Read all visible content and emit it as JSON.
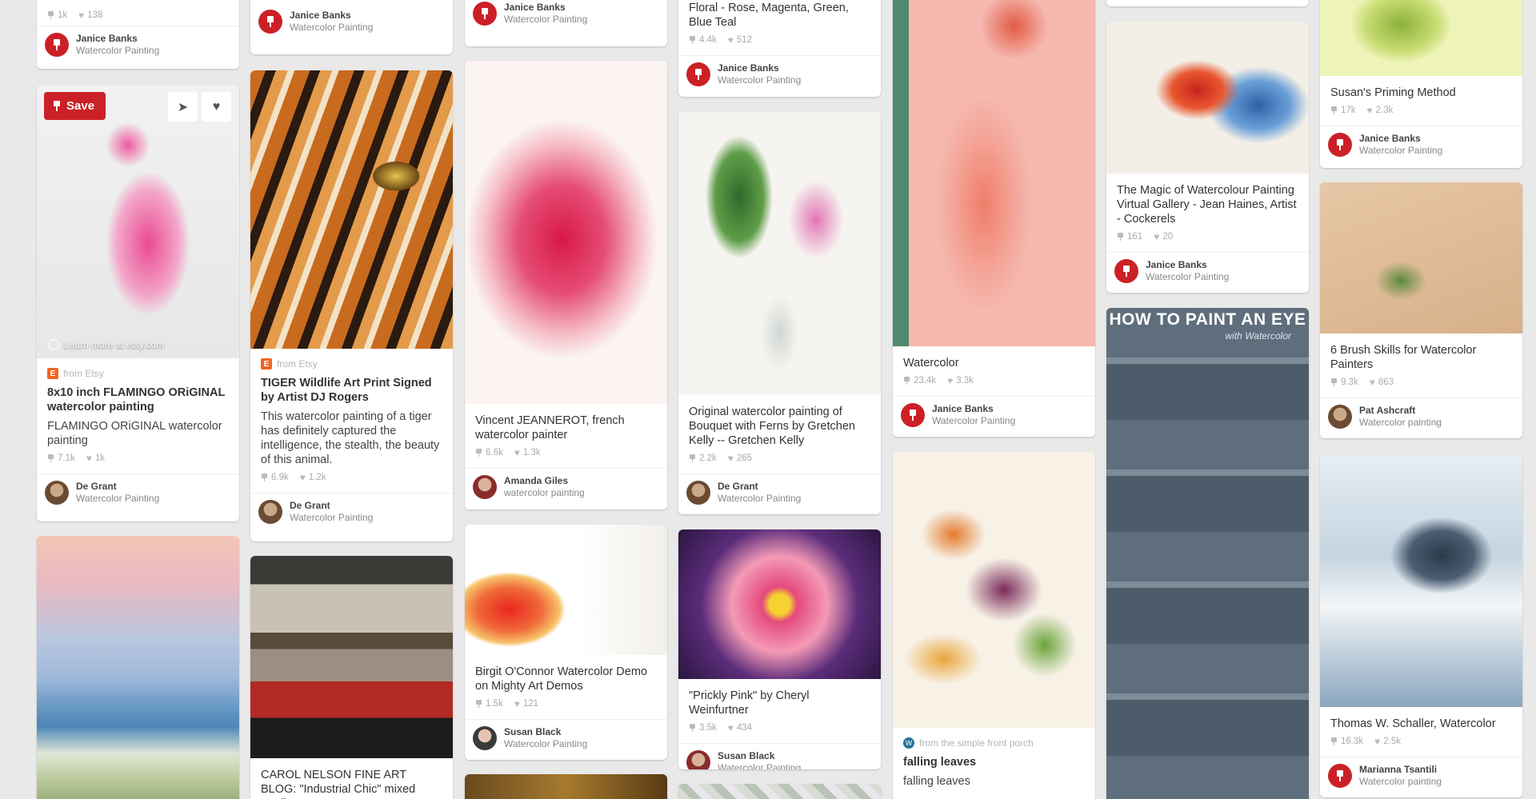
{
  "pins": {
    "c1a": {
      "stats_saves": "1k",
      "stats_likes": "138",
      "user_name": "Janice Banks",
      "board": "Watercolor Painting"
    },
    "c1b": {
      "save_label": "Save",
      "learn_more": "Learn more at etsy.com",
      "source": "from Etsy",
      "title": "8x10 inch FLAMINGO ORiGINAL watercolor painting",
      "desc": "FLAMINGO ORiGINAL watercolor painting",
      "stats_saves": "7.1k",
      "stats_likes": "1k",
      "user_name": "De Grant",
      "board": "Watercolor Painting"
    },
    "c2a": {
      "user_name": "Janice Banks",
      "board": "Watercolor Painting"
    },
    "c2b": {
      "source": "from Etsy",
      "title": "TIGER Wildlife Art Print Signed by Artist DJ Rogers",
      "desc": "This watercolor painting of a tiger has definitely captured the intelligence, the stealth, the beauty of this animal.",
      "stats_saves": "6.9k",
      "stats_likes": "1.2k",
      "user_name": "De Grant",
      "board": "Watercolor Painting"
    },
    "c2c": {
      "title": "CAROL NELSON FINE ART BLOG: \"Industrial Chic\" mixed media"
    },
    "c3a": {
      "user_name": "Janice Banks",
      "board": "Watercolor Painting"
    },
    "c3b": {
      "title": "Vincent JEANNEROT, french watercolor painter",
      "stats_saves": "6.6k",
      "stats_likes": "1.3k",
      "user_name": "Amanda Giles",
      "board": "watercolor painting"
    },
    "c3c": {
      "title": "Birgit O'Connor Watercolor Demo on Mighty Art Demos",
      "stats_saves": "1.5k",
      "stats_likes": "121",
      "user_name": "Susan Black",
      "board": "Watercolor Painting"
    },
    "c4a": {
      "title": "Floral - Rose, Magenta, Green, Blue Teal",
      "stats_saves": "4.4k",
      "stats_likes": "512",
      "user_name": "Janice Banks",
      "board": "Watercolor Painting"
    },
    "c4b": {
      "title": "Original watercolor painting of Bouquet with Ferns by Gretchen Kelly -- Gretchen Kelly",
      "stats_saves": "2.2k",
      "stats_likes": "265",
      "user_name": "De Grant",
      "board": "Watercolor Painting"
    },
    "c4c": {
      "title": "\"Prickly Pink\" by Cheryl Weinfurtner",
      "stats_saves": "3.5k",
      "stats_likes": "434",
      "user_name": "Susan Black",
      "board": "Watercolor Painting"
    },
    "c5a": {
      "title": "Watercolor",
      "stats_saves": "23.4k",
      "stats_likes": "3.3k",
      "user_name": "Janice Banks",
      "board": "Watercolor Painting"
    },
    "c5b": {
      "source": "from the simple front porch",
      "title": "falling leaves",
      "desc": "falling leaves"
    },
    "c6a": {
      "title": "The Magic of Watercolour Painting Virtual Gallery - Jean Haines, Artist - Cockerels",
      "stats_saves": "161",
      "stats_likes": "20",
      "user_name": "Janice Banks",
      "board": "Watercolor Painting"
    },
    "c6b": {
      "poster_title": "HOW TO PAINT AN EYE",
      "poster_sub": "with Watercolor"
    },
    "c7a": {
      "title": "Susan's Priming Method",
      "stats_saves": "17k",
      "stats_likes": "2.3k",
      "user_name": "Janice Banks",
      "board": "Watercolor Painting"
    },
    "c7b": {
      "title": "6 Brush Skills for Watercolor Painters",
      "stats_saves": "9.3k",
      "stats_likes": "863",
      "user_name": "Pat Ashcraft",
      "board": "Watercolor painting"
    },
    "c7c": {
      "title": "Thomas W. Schaller, Watercolor",
      "stats_saves": "16.3k",
      "stats_likes": "2.5k",
      "user_name": "Marianna Tsantili",
      "board": "Watercolor painting"
    }
  },
  "colors": {
    "brand_red": "#cb2027",
    "background": "#e9e9e9"
  },
  "icons": [
    "pin-icon",
    "heart-icon",
    "send-icon",
    "globe-icon",
    "etsy-icon",
    "wordpress-icon"
  ]
}
